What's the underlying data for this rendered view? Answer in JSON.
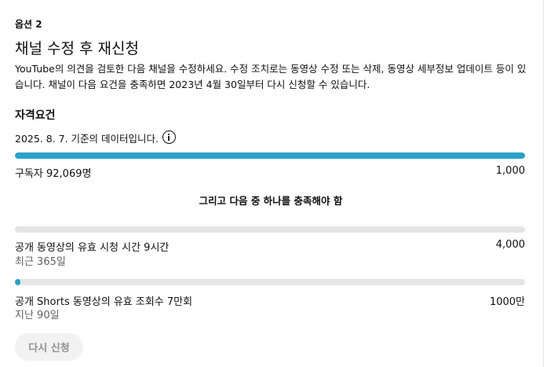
{
  "option": {
    "label": "옵션 2",
    "title": "채널 수정 후 재신청",
    "description": "YouTube의 의견을 검토한 다음 채널을 수정하세요. 수정 조치로는 동영상 수정 또는 삭제, 동영상 세부정보 업데이트 등이 있습니다. 채널이 다음 요건을 충족하면 2023년 4월 30일부터 다시 신청할 수 있습니다."
  },
  "eligibility": {
    "title": "자격요건",
    "as_of": "2025. 8. 7. 기준의 데이터입니다.",
    "info_icon": "info-icon",
    "or_text": "그리고 다음 중 하나를 충족해야 함",
    "metrics": [
      {
        "label": "구독자 92,069명",
        "sub": "",
        "target": "1,000",
        "progress": 1.0
      },
      {
        "label": "공개 동영상의 유효 시청 시간 9시간",
        "sub": "최근 365일",
        "target": "4,000",
        "progress": 0.0
      },
      {
        "label": "공개 Shorts 동영상의 유효 조회수 7만회",
        "sub": "지난 90일",
        "target": "1000만",
        "progress": 0.01
      }
    ],
    "accent_color": "#2ba1c7"
  },
  "actions": {
    "reapply_label": "다시 신청"
  }
}
